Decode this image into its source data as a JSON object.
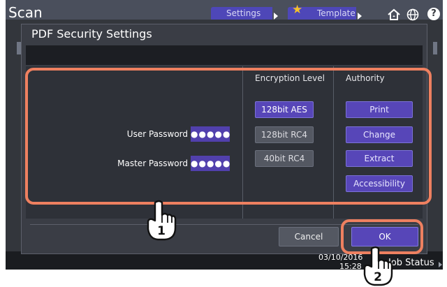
{
  "app": {
    "title": "Scan",
    "top_buttons": [
      {
        "label": "Settings"
      },
      {
        "label": "Template"
      }
    ],
    "status_bar": {
      "date": "03/10/2016",
      "time": "15:28",
      "job_status": "Job Status"
    }
  },
  "dialog": {
    "title": "PDF Security Settings",
    "user_password": {
      "label": "User Password",
      "value": "●●●●●"
    },
    "master_password": {
      "label": "Master Password",
      "value": "●●●●●"
    },
    "encryption": {
      "header": "Encryption Level",
      "options": [
        {
          "label": "128bit AES",
          "selected": true
        },
        {
          "label": "128bit RC4",
          "selected": false
        },
        {
          "label": "40bit RC4",
          "selected": false
        }
      ]
    },
    "authority": {
      "header": "Authority",
      "options": [
        {
          "label": "Print"
        },
        {
          "label": "Change"
        },
        {
          "label": "Extract"
        },
        {
          "label": "Accessibility"
        }
      ]
    },
    "cancel_label": "Cancel",
    "ok_label": "OK"
  },
  "callouts": [
    {
      "number": "1"
    },
    {
      "number": "2"
    }
  ],
  "colors": {
    "accent": "#5746b8",
    "callout": "#ee8060",
    "background": "#33363c"
  },
  "icons": {
    "home": "home-icon",
    "globe": "globe-icon",
    "help": "help-icon",
    "template_star": "star-icon",
    "pointer": "pointing-hand-icon"
  }
}
